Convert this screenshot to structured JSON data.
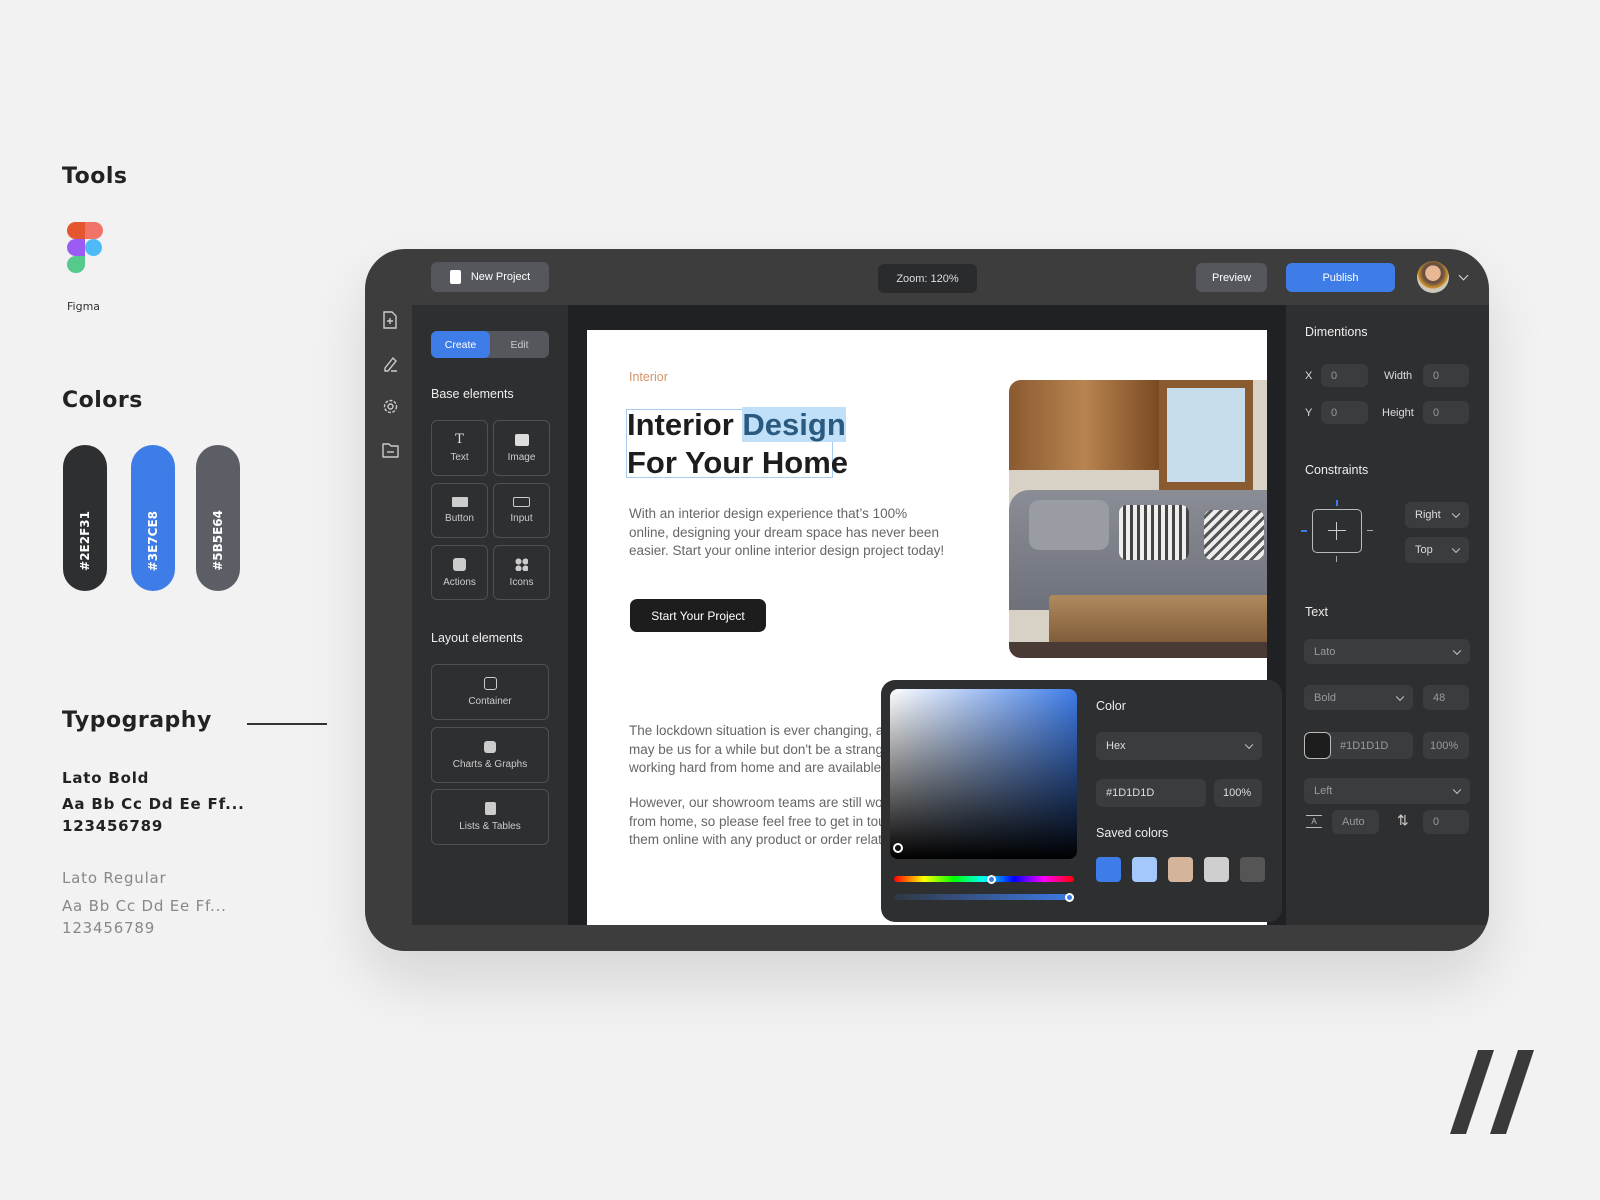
{
  "sidebar_info": {
    "tools_title": "Tools",
    "tool_name": "Figma",
    "colors_title": "Colors",
    "colors": [
      {
        "hex": "#2E2F31",
        "label": "#2E2F31"
      },
      {
        "hex": "#3E7CE8",
        "label": "#3E7CE8"
      },
      {
        "hex": "#5B5E64",
        "label": "#5B5E64"
      }
    ],
    "typography_title": "Typography",
    "bold_name": "Lato Bold",
    "bold_sample": "Aa Bb Cc Dd Ee Ff...",
    "bold_numbers": "123456789",
    "regular_name": "Lato Regular",
    "regular_sample": "Aa Bb Cc Dd Ee Ff...",
    "regular_numbers": "123456789"
  },
  "topbar": {
    "new_project": "New Project",
    "zoom": "Zoom: 120%",
    "preview": "Preview",
    "publish": "Publish"
  },
  "rail": {
    "icons": [
      "file-add-icon",
      "pencil-icon",
      "gear-icon",
      "folder-icon"
    ]
  },
  "left_panel": {
    "tabs": [
      "Create",
      "Edit"
    ],
    "active_tab": "Create",
    "base_title": "Base elements",
    "base_items": [
      "Text",
      "Image",
      "Button",
      "Input",
      "Actions",
      "Icons"
    ],
    "layout_title": "Layout elements",
    "layout_items": [
      "Container",
      "Charts & Graphs",
      "Lists & Tables"
    ]
  },
  "page": {
    "eyebrow": "Interior",
    "heading_1a": "Interior ",
    "heading_1b": "Design",
    "heading_2": "For Your Home",
    "intro": [
      "With an interior design experience that’s 100%",
      "online, designing your dream space has never been",
      "easier. Start your online interior design project today!"
    ],
    "cta": "Start Your Project",
    "body_1": [
      "The lockdown situation is ever changing, and i",
      "may be us for a while but don't be a stranger. C",
      "working hard from home and are available on l"
    ],
    "body_2": [
      "However, our showroom teams are still workin",
      "from home, so please feel free to get in touch",
      "them online with any product or order related"
    ]
  },
  "color_picker": {
    "title": "Color",
    "format": "Hex",
    "hex": "#1D1D1D",
    "opacity": "100%",
    "saved_title": "Saved colors",
    "saved": [
      "#3E7CE8",
      "#A4C8FB",
      "#D4B49A",
      "#CFCFCF",
      "#555555"
    ]
  },
  "properties": {
    "dimensions_title": "Dimentions",
    "x_label": "X",
    "x": "0",
    "y_label": "Y",
    "y": "0",
    "width_label": "Width",
    "width": "0",
    "height_label": "Height",
    "height": "0",
    "constraints_title": "Constraints",
    "h_constraint": "Right",
    "v_constraint": "Top",
    "text_title": "Text",
    "font": "Lato",
    "weight": "Bold",
    "size": "48",
    "color_hex": "#1D1D1D",
    "color_opacity": "100%",
    "align": "Left",
    "line_height": "Auto",
    "letter_spacing": "0"
  }
}
